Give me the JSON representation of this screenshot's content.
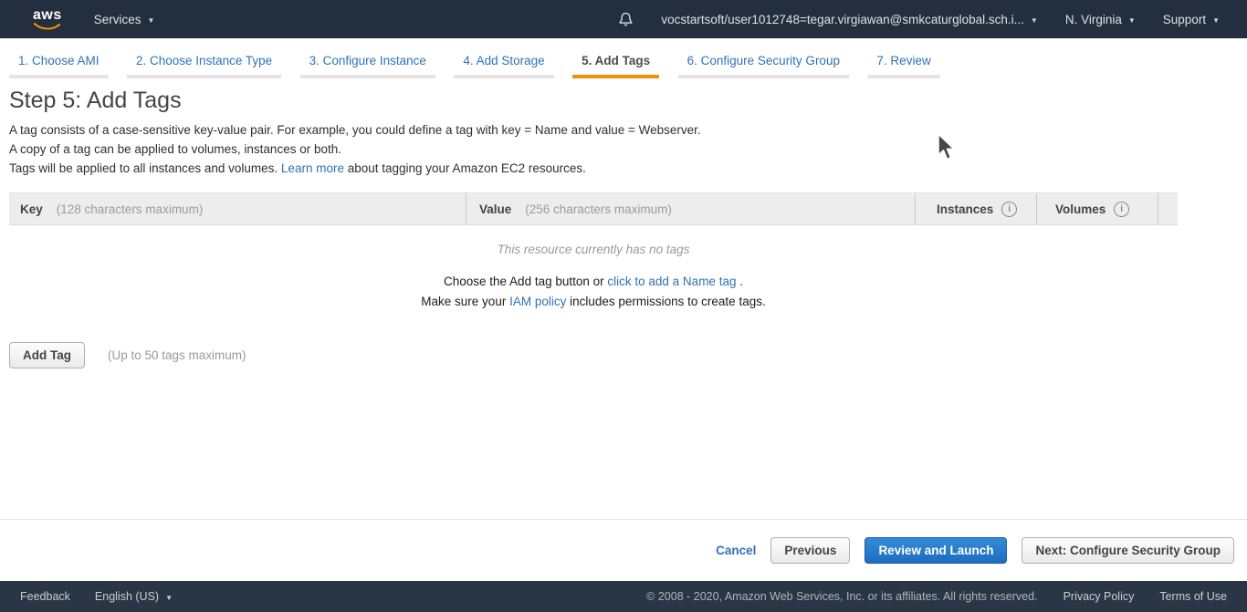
{
  "topnav": {
    "logo_text": "aws",
    "services_label": "Services",
    "user_label": "vocstartsoft/user1012748=tegar.virgiawan@smkcaturglobal.sch.i...",
    "region_label": "N. Virginia",
    "support_label": "Support"
  },
  "icons": {
    "caret_down": "▼",
    "info_glyph": "i"
  },
  "tabs": [
    {
      "label": "1. Choose AMI",
      "active": false
    },
    {
      "label": "2. Choose Instance Type",
      "active": false
    },
    {
      "label": "3. Configure Instance",
      "active": false
    },
    {
      "label": "4. Add Storage",
      "active": false
    },
    {
      "label": "5. Add Tags",
      "active": true
    },
    {
      "label": "6. Configure Security Group",
      "active": false
    },
    {
      "label": "7. Review",
      "active": false
    }
  ],
  "main": {
    "title": "Step 5: Add Tags",
    "desc_line1": "A tag consists of a case-sensitive key-value pair. For example, you could define a tag with key = Name and value = Webserver.",
    "desc_line2": "A copy of a tag can be applied to volumes, instances or both.",
    "desc_line3_pre": "Tags will be applied to all instances and volumes. ",
    "desc_line3_link": "Learn more",
    "desc_line3_post": " about tagging your Amazon EC2 resources.",
    "table": {
      "key_header": "Key",
      "key_hint": "(128 characters maximum)",
      "value_header": "Value",
      "value_hint": "(256 characters maximum)",
      "instances_header": "Instances",
      "volumes_header": "Volumes"
    },
    "empty": {
      "no_tags": "This resource currently has no tags",
      "line1_pre": "Choose the Add tag button or ",
      "line1_link": "click to add a Name tag",
      "line1_post": " .",
      "line2_pre": "Make sure your ",
      "line2_link": "IAM policy",
      "line2_post": " includes permissions to create tags."
    },
    "add_tag_button": "Add Tag",
    "max_tags_hint": "(Up to 50 tags maximum)"
  },
  "actionbar": {
    "cancel_label": "Cancel",
    "previous_label": "Previous",
    "review_launch_label": "Review and Launch",
    "next_label": "Next: Configure Security Group"
  },
  "footer": {
    "feedback_label": "Feedback",
    "language_label": "English (US)",
    "copyright": "© 2008 - 2020, Amazon Web Services, Inc. or its affiliates. All rights reserved.",
    "privacy_label": "Privacy Policy",
    "terms_label": "Terms of Use"
  },
  "colors": {
    "nav_bg": "#232f3e",
    "footer_bg": "#2a3545",
    "accent_orange": "#ef9008",
    "link_blue": "#2e73b8",
    "primary_button_blue": "#1c6fc0"
  }
}
